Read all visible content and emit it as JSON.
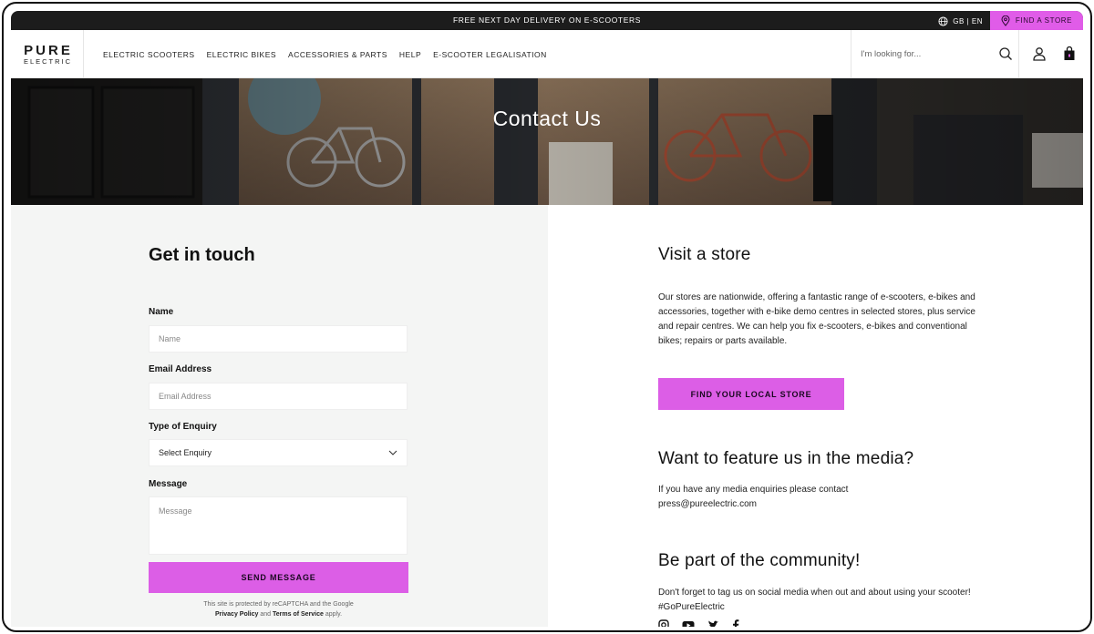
{
  "promo": {
    "text": "FREE NEXT DAY DELIVERY ON E-SCOOTERS",
    "locale": "GB | EN",
    "find_store": "FIND A STORE"
  },
  "nav": {
    "logo_main": "PURE",
    "logo_sub": "ELECTRIC",
    "menu": [
      "ELECTRIC SCOOTERS",
      "ELECTRIC BIKES",
      "ACCESSORIES & PARTS",
      "HELP",
      "E-SCOOTER LEGALISATION"
    ],
    "search_placeholder": "I'm looking for..."
  },
  "hero": {
    "title": "Contact Us"
  },
  "form": {
    "heading": "Get in touch",
    "name_label": "Name",
    "name_placeholder": "Name",
    "email_label": "Email Address",
    "email_placeholder": "Email Address",
    "enquiry_label": "Type of Enquiry",
    "enquiry_selected": "Select Enquiry",
    "message_label": "Message",
    "message_placeholder": "Message",
    "send_label": "SEND MESSAGE",
    "recaptcha_pre": "This site is protected by reCAPTCHA and the Google",
    "privacy": "Privacy Policy",
    "and": "and",
    "terms": "Terms of Service",
    "apply": "apply."
  },
  "info": {
    "store_heading": "Visit a store",
    "store_text": "Our stores are nationwide, offering a fantastic range of e-scooters, e-bikes and accessories, together with e-bike demo centres in selected stores, plus service and repair centres. We can help you fix e-scooters, e-bikes and conventional bikes; repairs or parts available.",
    "store_button": "FIND YOUR LOCAL STORE",
    "media_heading": "Want to feature us in the media?",
    "media_text": "If you have any media enquiries please contact press@pureelectric.com",
    "community_heading": "Be part of the community!",
    "community_text": "Don't forget to tag us on social media when out and about using your scooter! #GoPureElectric"
  },
  "colors": {
    "accent": "#dc5ee6",
    "promo_bg": "#1c1c1c",
    "form_bg": "#f4f5f4"
  },
  "icons": [
    "globe-icon",
    "map-pin-icon",
    "search-icon",
    "account-icon",
    "bag-icon",
    "chevron-down-icon",
    "instagram-icon",
    "youtube-icon",
    "twitter-icon",
    "facebook-icon"
  ]
}
